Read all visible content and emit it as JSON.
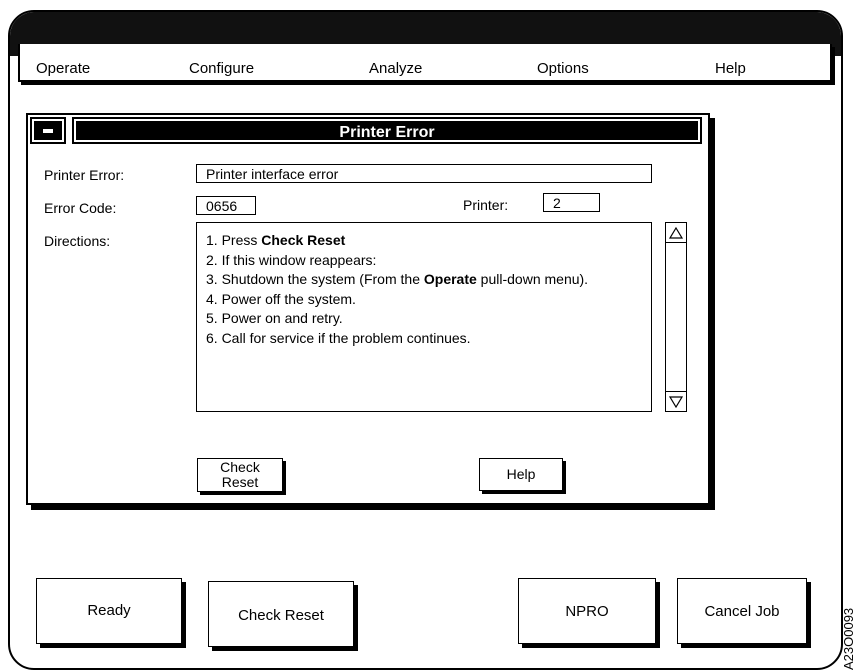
{
  "menu": {
    "items": [
      "Operate",
      "Configure",
      "Analyze",
      "Options",
      "Help"
    ]
  },
  "dialog": {
    "title": "Printer Error",
    "printer_error_label": "Printer Error:",
    "printer_error_value": "Printer interface error",
    "error_code_label": "Error Code:",
    "error_code_value": "0656",
    "printer_label": "Printer:",
    "printer_value": "2",
    "directions_label": "Directions:",
    "directions": [
      {
        "prefix": "1. Press ",
        "bold": "Check Reset",
        "suffix": ""
      },
      {
        "prefix": "2. If this window reappears:",
        "bold": "",
        "suffix": ""
      },
      {
        "prefix": "3. Shutdown the system (From the ",
        "bold": "Operate",
        "suffix": " pull-down menu)."
      },
      {
        "prefix": "4. Power off the system.",
        "bold": "",
        "suffix": ""
      },
      {
        "prefix": "5. Power on and retry.",
        "bold": "",
        "suffix": ""
      },
      {
        "prefix": "6. Call for service if the problem continues.",
        "bold": "",
        "suffix": ""
      }
    ],
    "check_reset_line1": "Check",
    "check_reset_line2": "Reset",
    "help_label": "Help"
  },
  "bottom_buttons": {
    "ready": "Ready",
    "check_reset": "Check Reset",
    "npro": "NPRO",
    "cancel_job": "Cancel Job"
  },
  "figure_code": "A23O0093",
  "icons": {
    "close": "window-menu-icon",
    "scroll_up": "scroll-up-icon",
    "scroll_down": "scroll-down-icon"
  }
}
